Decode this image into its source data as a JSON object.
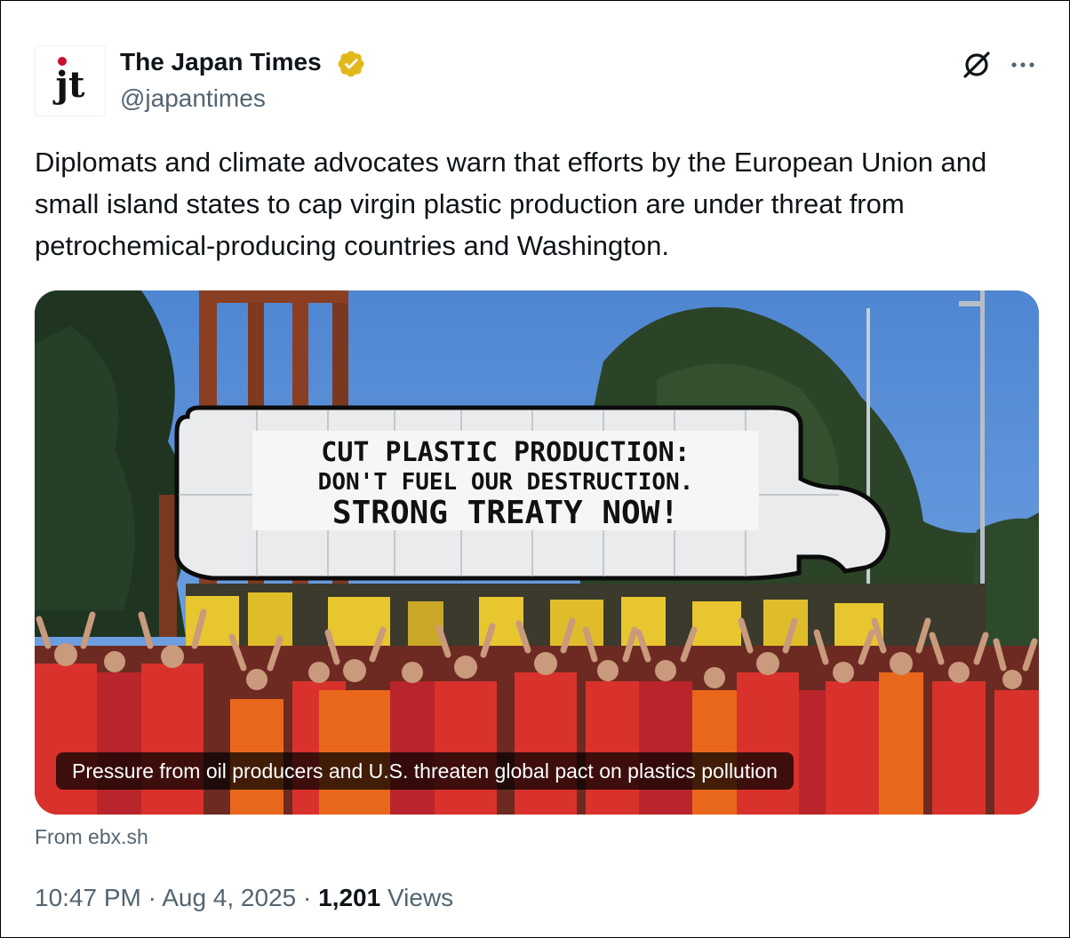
{
  "author": {
    "avatar_text": "jt",
    "name": "The Japan Times",
    "handle": "@japantimes",
    "verified_badge_color": "#e2b719"
  },
  "header_icons": {
    "grok": "grok-icon",
    "more": "more-icon"
  },
  "tweet": {
    "text": "Diplomats and climate advocates warn that efforts by the European Union and small island states to cap virgin plastic production are under threat from petrochemical-producing countries and Washington."
  },
  "card": {
    "banner_lines": [
      "CUT PLASTIC PRODUCTION:",
      "DON'T FUEL OUR DESTRUCTION.",
      "STRONG TREATY NOW!"
    ],
    "caption": "Pressure from oil producers and U.S. threaten global pact on plastics pollution",
    "source": "From ebx.sh"
  },
  "meta": {
    "time": "10:47 PM",
    "separator": "·",
    "date": "Aug 4, 2025",
    "views_count": "1,201",
    "views_label": "Views"
  },
  "colors": {
    "text_primary": "#0f1419",
    "text_secondary": "#536471",
    "accent_red": "#c8102e"
  }
}
